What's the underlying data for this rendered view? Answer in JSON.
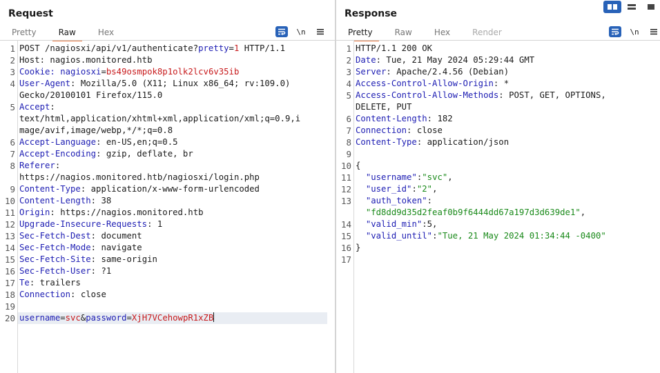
{
  "request": {
    "title": "Request",
    "tabs": [
      {
        "label": "Pretty",
        "active": false
      },
      {
        "label": "Raw",
        "active": true
      },
      {
        "label": "Hex",
        "active": false
      }
    ],
    "newline_label": "\\n",
    "lines": [
      {
        "n": "1",
        "parts": [
          {
            "t": "POST /nagiosxi/api/v1/authenticate?"
          },
          {
            "t": "pretty",
            "c": "pk"
          },
          {
            "t": "="
          },
          {
            "t": "1",
            "c": "pv"
          },
          {
            "t": " HTTP/1.1"
          }
        ]
      },
      {
        "n": "2",
        "parts": [
          {
            "t": "Host: nagios.monitored.htb"
          }
        ]
      },
      {
        "n": "3",
        "parts": [
          {
            "t": "Cookie: ",
            "c": "hk"
          },
          {
            "t": "nagiosxi",
            "c": "pk"
          },
          {
            "t": "="
          },
          {
            "t": "bs49osmpok8p1olk2lcv6v35ib",
            "c": "pv"
          }
        ]
      },
      {
        "n": "4",
        "parts": [
          {
            "t": "User-Agent",
            "c": "hk"
          },
          {
            "t": ": Mozilla/5.0 (X11; Linux x86_64; rv:109.0)"
          }
        ]
      },
      {
        "n": "",
        "parts": [
          {
            "t": "Gecko/20100101 Firefox/115.0"
          }
        ]
      },
      {
        "n": "5",
        "parts": [
          {
            "t": "Accept",
            "c": "hk"
          },
          {
            "t": ":"
          }
        ]
      },
      {
        "n": "",
        "parts": [
          {
            "t": "text/html,application/xhtml+xml,application/xml;q=0.9,i"
          }
        ]
      },
      {
        "n": "",
        "parts": [
          {
            "t": "mage/avif,image/webp,*/*;q=0.8"
          }
        ]
      },
      {
        "n": "6",
        "parts": [
          {
            "t": "Accept-Language",
            "c": "hk"
          },
          {
            "t": ": en-US,en;q=0.5"
          }
        ]
      },
      {
        "n": "7",
        "parts": [
          {
            "t": "Accept-Encoding",
            "c": "hk"
          },
          {
            "t": ": gzip, deflate, br"
          }
        ]
      },
      {
        "n": "8",
        "parts": [
          {
            "t": "Referer",
            "c": "hk"
          },
          {
            "t": ":"
          }
        ]
      },
      {
        "n": "",
        "parts": [
          {
            "t": "https://nagios.monitored.htb/nagiosxi/login.php"
          }
        ]
      },
      {
        "n": "9",
        "parts": [
          {
            "t": "Content-Type",
            "c": "hk"
          },
          {
            "t": ": application/x-www-form-urlencoded"
          }
        ]
      },
      {
        "n": "10",
        "parts": [
          {
            "t": "Content-Length",
            "c": "hk"
          },
          {
            "t": ": 38"
          }
        ]
      },
      {
        "n": "11",
        "parts": [
          {
            "t": "Origin",
            "c": "hk"
          },
          {
            "t": ": https://nagios.monitored.htb"
          }
        ]
      },
      {
        "n": "12",
        "parts": [
          {
            "t": "Upgrade-Insecure-Requests",
            "c": "hk"
          },
          {
            "t": ": 1"
          }
        ]
      },
      {
        "n": "13",
        "parts": [
          {
            "t": "Sec-Fetch-Dest",
            "c": "hk"
          },
          {
            "t": ": document"
          }
        ]
      },
      {
        "n": "14",
        "parts": [
          {
            "t": "Sec-Fetch-Mode",
            "c": "hk"
          },
          {
            "t": ": navigate"
          }
        ]
      },
      {
        "n": "15",
        "parts": [
          {
            "t": "Sec-Fetch-Site",
            "c": "hk"
          },
          {
            "t": ": same-origin"
          }
        ]
      },
      {
        "n": "16",
        "parts": [
          {
            "t": "Sec-Fetch-User",
            "c": "hk"
          },
          {
            "t": ": ?1"
          }
        ]
      },
      {
        "n": "17",
        "parts": [
          {
            "t": "Te",
            "c": "hk"
          },
          {
            "t": ": trailers"
          }
        ]
      },
      {
        "n": "18",
        "parts": [
          {
            "t": "Connection",
            "c": "hk"
          },
          {
            "t": ": close"
          }
        ]
      },
      {
        "n": "19",
        "parts": []
      },
      {
        "n": "20",
        "cur": true,
        "caret": true,
        "parts": [
          {
            "t": "username",
            "c": "pk"
          },
          {
            "t": "="
          },
          {
            "t": "svc",
            "c": "pv"
          },
          {
            "t": "&"
          },
          {
            "t": "password",
            "c": "pk"
          },
          {
            "t": "="
          },
          {
            "t": "XjH7VCehowpR1xZB",
            "c": "pv"
          }
        ]
      }
    ]
  },
  "response": {
    "title": "Response",
    "tabs": [
      {
        "label": "Pretty",
        "active": true
      },
      {
        "label": "Raw",
        "active": false
      },
      {
        "label": "Hex",
        "active": false
      },
      {
        "label": "Render",
        "active": false,
        "disabled": true
      }
    ],
    "newline_label": "\\n",
    "lines": [
      {
        "n": "1",
        "parts": [
          {
            "t": "HTTP/1.1 200 OK"
          }
        ]
      },
      {
        "n": "2",
        "parts": [
          {
            "t": "Date",
            "c": "hk"
          },
          {
            "t": ": Tue, 21 May 2024 05:29:44 GMT"
          }
        ]
      },
      {
        "n": "3",
        "parts": [
          {
            "t": "Server",
            "c": "hk"
          },
          {
            "t": ": Apache/2.4.56 (Debian)"
          }
        ]
      },
      {
        "n": "4",
        "parts": [
          {
            "t": "Access-Control-Allow-Origin",
            "c": "hk"
          },
          {
            "t": ": *"
          }
        ]
      },
      {
        "n": "5",
        "parts": [
          {
            "t": "Access-Control-Allow-Methods",
            "c": "hk"
          },
          {
            "t": ": POST, GET, OPTIONS,"
          }
        ]
      },
      {
        "n": "",
        "parts": [
          {
            "t": "DELETE, PUT"
          }
        ]
      },
      {
        "n": "6",
        "parts": [
          {
            "t": "Content-Length",
            "c": "hk"
          },
          {
            "t": ": 182"
          }
        ]
      },
      {
        "n": "7",
        "parts": [
          {
            "t": "Connection",
            "c": "hk"
          },
          {
            "t": ": close"
          }
        ]
      },
      {
        "n": "8",
        "parts": [
          {
            "t": "Content-Type",
            "c": "hk"
          },
          {
            "t": ": application/json"
          }
        ]
      },
      {
        "n": "9",
        "parts": []
      },
      {
        "n": "10",
        "parts": [
          {
            "t": "{"
          }
        ]
      },
      {
        "n": "11",
        "parts": [
          {
            "t": "  "
          },
          {
            "t": "\"username\"",
            "c": "sk"
          },
          {
            "t": ":"
          },
          {
            "t": "\"svc\"",
            "c": "sv"
          },
          {
            "t": ","
          }
        ]
      },
      {
        "n": "12",
        "parts": [
          {
            "t": "  "
          },
          {
            "t": "\"user_id\"",
            "c": "sk"
          },
          {
            "t": ":"
          },
          {
            "t": "\"2\"",
            "c": "sv"
          },
          {
            "t": ","
          }
        ]
      },
      {
        "n": "13",
        "parts": [
          {
            "t": "  "
          },
          {
            "t": "\"auth_token\"",
            "c": "sk"
          },
          {
            "t": ":"
          }
        ]
      },
      {
        "n": "",
        "parts": [
          {
            "t": "  "
          },
          {
            "t": "\"fd8dd9d35d2feaf0b9f6444dd67a197d3d639de1\"",
            "c": "sv"
          },
          {
            "t": ","
          }
        ]
      },
      {
        "n": "14",
        "parts": [
          {
            "t": "  "
          },
          {
            "t": "\"valid_min\"",
            "c": "sk"
          },
          {
            "t": ":5,"
          }
        ]
      },
      {
        "n": "15",
        "parts": [
          {
            "t": "  "
          },
          {
            "t": "\"valid_until\"",
            "c": "sk"
          },
          {
            "t": ":"
          },
          {
            "t": "\"Tue, 21 May 2024 01:34:44 -0400\"",
            "c": "sv"
          }
        ]
      },
      {
        "n": "16",
        "parts": [
          {
            "t": "}"
          }
        ]
      },
      {
        "n": "17",
        "parts": []
      }
    ]
  },
  "colors": {
    "accent_orange": "#e8773f",
    "accent_blue": "#2862b8",
    "header_key": "#1d1db3",
    "param_value": "#c7191b",
    "json_value": "#1a8a1a"
  }
}
